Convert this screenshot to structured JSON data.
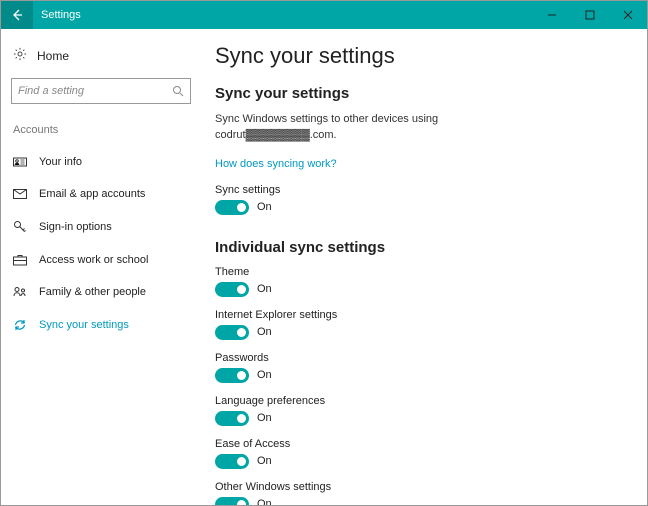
{
  "window": {
    "title": "Settings"
  },
  "sidebar": {
    "home": "Home",
    "search_placeholder": "Find a setting",
    "category": "Accounts",
    "items": [
      {
        "label": "Your info"
      },
      {
        "label": "Email & app accounts"
      },
      {
        "label": "Sign-in options"
      },
      {
        "label": "Access work or school"
      },
      {
        "label": "Family & other people"
      },
      {
        "label": "Sync your settings"
      }
    ]
  },
  "main": {
    "title": "Sync your settings",
    "section1_heading": "Sync your settings",
    "description": "Sync Windows settings to other devices using codrut▓▓▓▓▓▓▓▓.com.",
    "link": "How does syncing work?",
    "sync_settings": {
      "label": "Sync settings",
      "state": "On"
    },
    "section2_heading": "Individual sync settings",
    "toggles": [
      {
        "label": "Theme",
        "state": "On"
      },
      {
        "label": "Internet Explorer settings",
        "state": "On"
      },
      {
        "label": "Passwords",
        "state": "On"
      },
      {
        "label": "Language preferences",
        "state": "On"
      },
      {
        "label": "Ease of Access",
        "state": "On"
      },
      {
        "label": "Other Windows settings",
        "state": "On"
      }
    ]
  }
}
